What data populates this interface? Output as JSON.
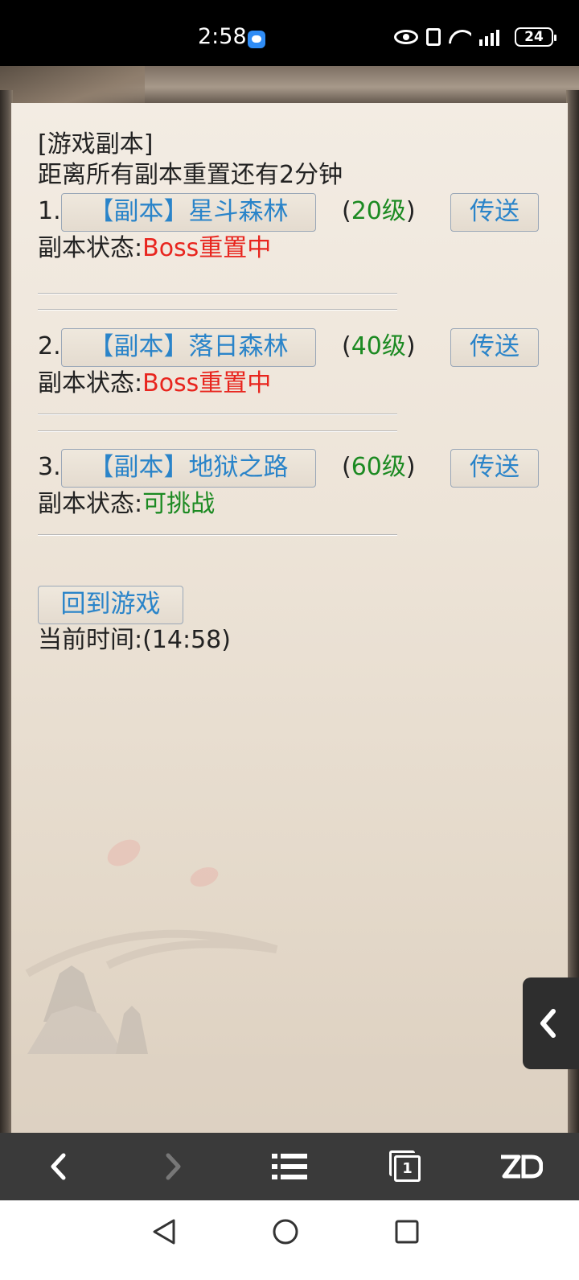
{
  "status_bar": {
    "time": "2:58",
    "battery": "24",
    "icons": [
      "message-icon",
      "eye-icon",
      "vibrate-icon",
      "wifi-icon",
      "4g-signal-icon",
      "battery-icon"
    ]
  },
  "dungeon": {
    "title": "[游戏副本]",
    "reset_notice": "距离所有副本重置还有2分钟",
    "status_label": "副本状态:",
    "teleport_label": "传送",
    "entries": [
      {
        "index": "1.",
        "name": "【副本】星斗森林",
        "level_open": "(",
        "level": "20级",
        "level_close": ")",
        "status": "Boss重置中",
        "status_color": "#e8251e"
      },
      {
        "index": "2.",
        "name": "【副本】落日森林",
        "level_open": "(",
        "level": "40级",
        "level_close": ")",
        "status": "Boss重置中",
        "status_color": "#e8251e"
      },
      {
        "index": "3.",
        "name": "【副本】地狱之路",
        "level_open": "(",
        "level": "60级",
        "level_close": ")",
        "status": "可挑战",
        "status_color": "#1c8a22"
      }
    ],
    "back_button": "回到游戏",
    "current_time": "当前时间:(14:58)"
  },
  "toolbar": {
    "tabs_count": "1",
    "items": [
      "back-icon",
      "forward-icon",
      "menu-list-icon",
      "tabs-icon",
      "zd-logo-icon"
    ]
  },
  "colors": {
    "link_blue": "#2a84c9",
    "level_green": "#1c8a22",
    "status_red": "#e8251e"
  }
}
